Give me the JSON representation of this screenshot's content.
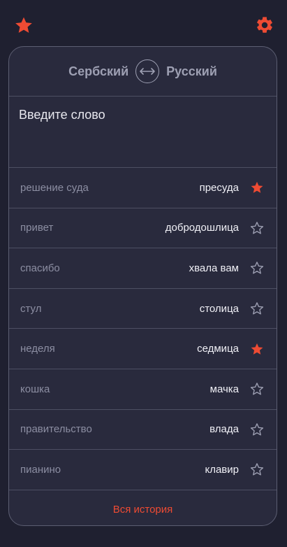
{
  "colors": {
    "background": "#1f2030",
    "card": "#292a3d",
    "accent": "#ee4b33",
    "muted_text": "#8c8ea2"
  },
  "header": {
    "favorites_icon": "star-icon",
    "settings_icon": "gear-icon"
  },
  "languages": {
    "source": "Сербский",
    "target": "Русский",
    "swap_icon": "swap-arrows-icon"
  },
  "input": {
    "placeholder": "Введите слово",
    "value": ""
  },
  "history_items": [
    {
      "source": "решение суда",
      "translation": "пресуда",
      "favorite": true
    },
    {
      "source": "привет",
      "translation": "добродошлица",
      "favorite": false
    },
    {
      "source": "спасибо",
      "translation": "хвала вам",
      "favorite": false
    },
    {
      "source": "стул",
      "translation": "столица",
      "favorite": false
    },
    {
      "source": "неделя",
      "translation": "седмица",
      "favorite": true
    },
    {
      "source": "кошка",
      "translation": "мачка",
      "favorite": false
    },
    {
      "source": "правительство",
      "translation": "влада",
      "favorite": false
    },
    {
      "source": "пианино",
      "translation": "клавир",
      "favorite": false
    }
  ],
  "footer": {
    "all_history_label": "Вся история"
  }
}
